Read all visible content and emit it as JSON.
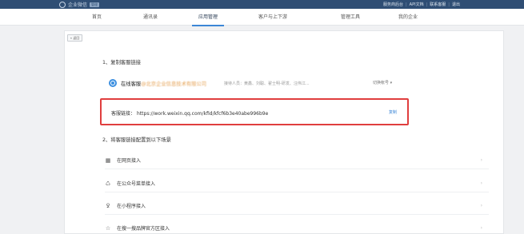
{
  "topbar": {
    "app_name": "企业微信",
    "badge": "管理",
    "links": [
      "服务商后台",
      "API文档",
      "联系客服",
      "退出"
    ]
  },
  "nav": {
    "tabs": [
      "首页",
      "通讯录",
      "应用管理",
      "客户与上下游",
      "管理工具",
      "我的企业"
    ],
    "active_index": 2
  },
  "back_label": "« 返回",
  "step1": {
    "title": "1、复制客服链接",
    "service_name": "在线客服",
    "service_org": "@北京企业信息技术有限公司",
    "staff": "接待人员：黄鑫、刘聪、翟士明-研发、汪伟江...",
    "switch_label": "切换帐号 ▾"
  },
  "link_box": {
    "label": "客服链接：",
    "url": "https://work.weixin.qq.com/kfid/kfcf6b3e40abe996b9e",
    "copy_label": "复制"
  },
  "step2": {
    "title": "2、将客服链接配置到以下场景",
    "scenes": [
      {
        "label": "在网页接入",
        "icon": "webpage-icon"
      },
      {
        "label": "在公众号菜单接入",
        "icon": "official-account-icon"
      },
      {
        "label": "在小程序接入",
        "icon": "mini-program-icon"
      },
      {
        "label": "在搜一搜品牌官方区接入",
        "icon": "search-brand-icon"
      }
    ]
  },
  "colors": {
    "topbar": "#2f4e74",
    "accent": "#3b86d6",
    "highlight_border": "#e03e3e"
  }
}
